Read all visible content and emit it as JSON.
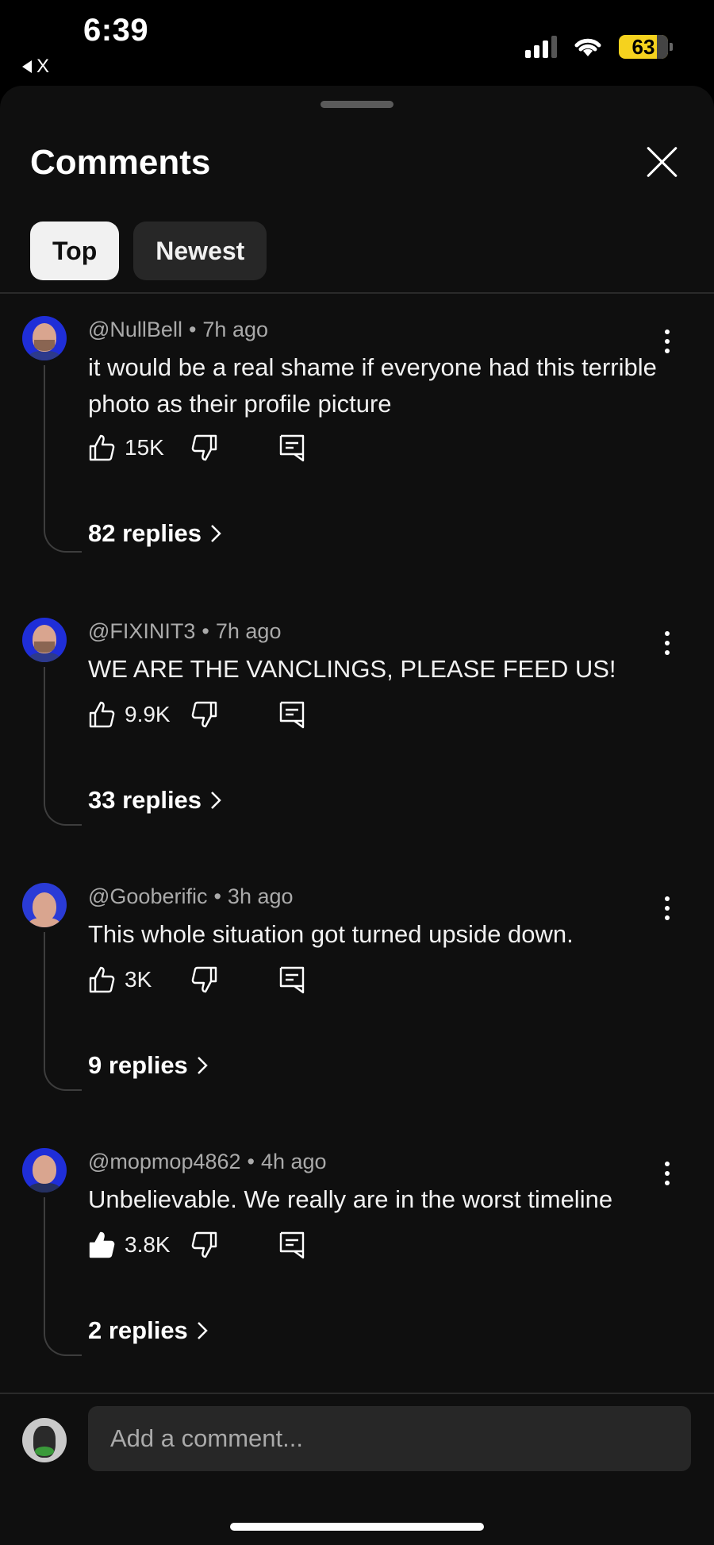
{
  "status_bar": {
    "time": "6:39",
    "back_app": "X",
    "battery": "63",
    "battery_color": "#f5d21e"
  },
  "sheet": {
    "title": "Comments",
    "tabs": [
      {
        "label": "Top",
        "active": true
      },
      {
        "label": "Newest",
        "active": false
      }
    ]
  },
  "comments": [
    {
      "author": "@NullBell",
      "age": "7h ago",
      "text": "it would be a real shame if everyone had this terrible photo as their profile picture",
      "likes": "15K",
      "replies": "82 replies",
      "liked": false
    },
    {
      "author": "@FIXINIT3",
      "age": "7h ago",
      "text": "WE ARE THE VANCLINGS, PLEASE FEED US!",
      "likes": "9.9K",
      "replies": "33 replies",
      "liked": false
    },
    {
      "author": "@Gooberific",
      "age": "3h ago",
      "text": "This whole situation got turned upside down.",
      "likes": "3K",
      "replies": "9 replies",
      "liked": false
    },
    {
      "author": "@mopmop4862",
      "age": "4h ago",
      "text": "Unbelievable. We really are in the worst timeline",
      "likes": "3.8K",
      "replies": "2 replies",
      "liked": true
    }
  ],
  "composer": {
    "placeholder": "Add a comment..."
  },
  "colors": {
    "background": "#0f0f0f",
    "chip_active": "#f1f1f1",
    "chip_inactive": "#272727",
    "secondary_text": "#aaaaaa",
    "avatar_blue": "#1f2ed8"
  }
}
